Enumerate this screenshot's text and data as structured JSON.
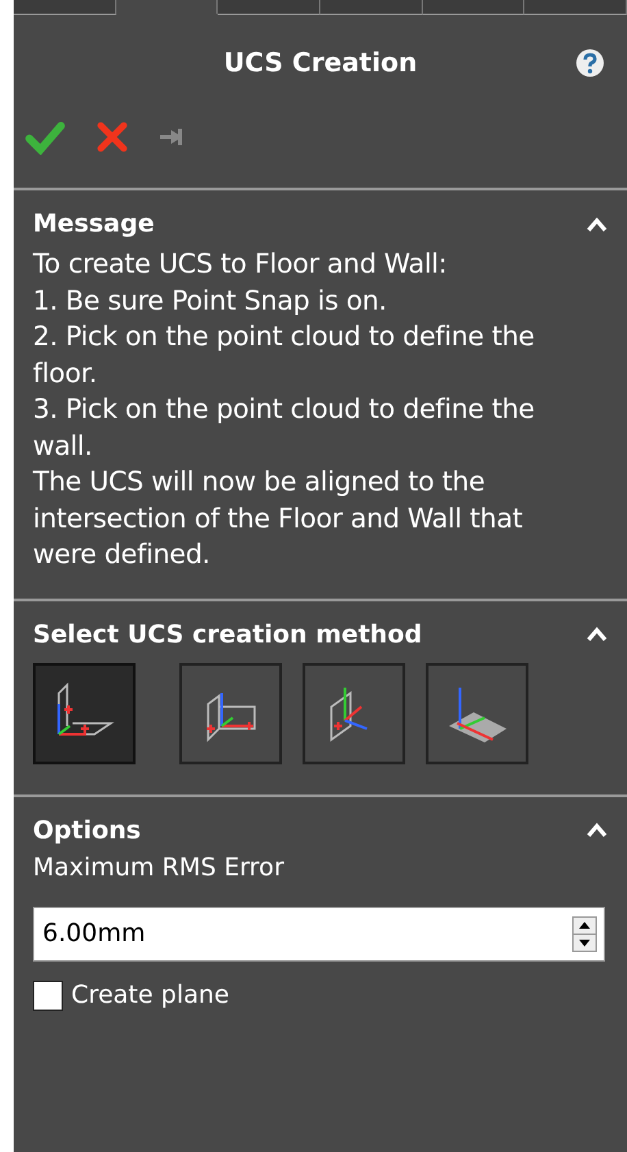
{
  "tabs": [
    {
      "selected": false
    },
    {
      "selected": true
    },
    {
      "selected": false
    },
    {
      "selected": false
    },
    {
      "selected": false
    },
    {
      "selected": false
    }
  ],
  "title": "UCS Creation",
  "sections": [
    {
      "kind": "message",
      "title": "Message",
      "expanded": true,
      "lines": [
        "To create UCS to Floor and Wall:",
        "1. Be sure Point Snap is on.",
        "2. Pick on the point cloud to define the",
        "floor.",
        "3. Pick on the point cloud to define the",
        "wall.",
        "The UCS will now be aligned to the",
        "intersection of the Floor and Wall that",
        "were defined."
      ]
    },
    {
      "kind": "methods",
      "title": "Select UCS creation method",
      "expanded": true,
      "methods": [
        {
          "kind": "floorwall",
          "selected": true
        },
        {
          "kind": "wallpoint",
          "selected": false
        },
        {
          "kind": "planez",
          "selected": false
        },
        {
          "kind": "flooredge",
          "selected": false
        }
      ]
    },
    {
      "kind": "options",
      "title": "Options",
      "expanded": true,
      "field_label": "Maximum RMS Error",
      "value": "6.00mm",
      "checkbox": {
        "label": "Create plane",
        "checked": false
      }
    }
  ]
}
